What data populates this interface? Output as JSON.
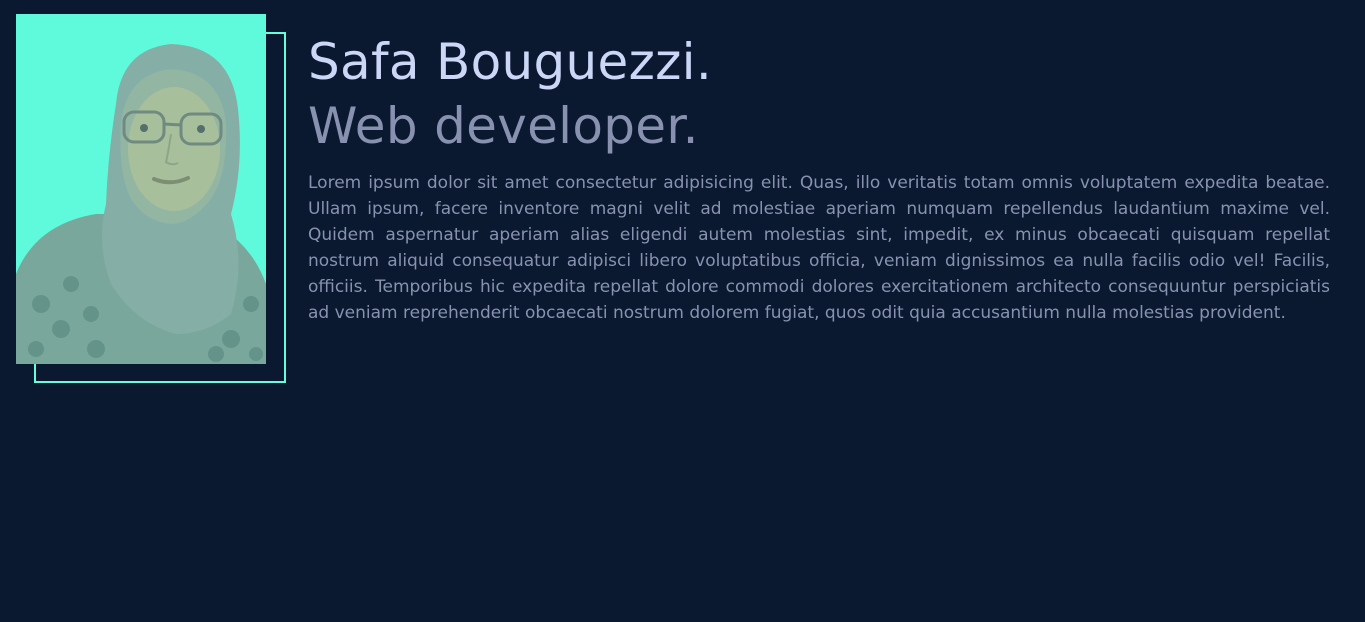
{
  "profile": {
    "name": "Safa Bouguezzi.",
    "role": "Web developer.",
    "bio": "Lorem ipsum dolor sit amet consectetur adipisicing elit. Quas, illo veritatis totam omnis voluptatem expedita beatae. Ullam ipsum, facere inventore magni velit ad molestiae aperiam numquam repellendus laudantium maxime vel. Quidem aspernatur aperiam alias eligendi autem molestias sint, impedit, ex minus obcaecati quisquam repellat nostrum aliquid consequatur adipisci libero voluptatibus officia, veniam dignissimos ea nulla facilis odio vel! Facilis, officiis. Temporibus hic expedita repellat dolore commodi dolores exercitationem architecto consequuntur perspiciatis ad veniam reprehenderit obcaecati nostrum dolorem fugiat, quos odit quia accusantium nulla molestias provident."
  },
  "colors": {
    "background": "#0a192f",
    "accent": "#64ffda",
    "heading": "#ccd6f6",
    "text": "#8892b0"
  }
}
